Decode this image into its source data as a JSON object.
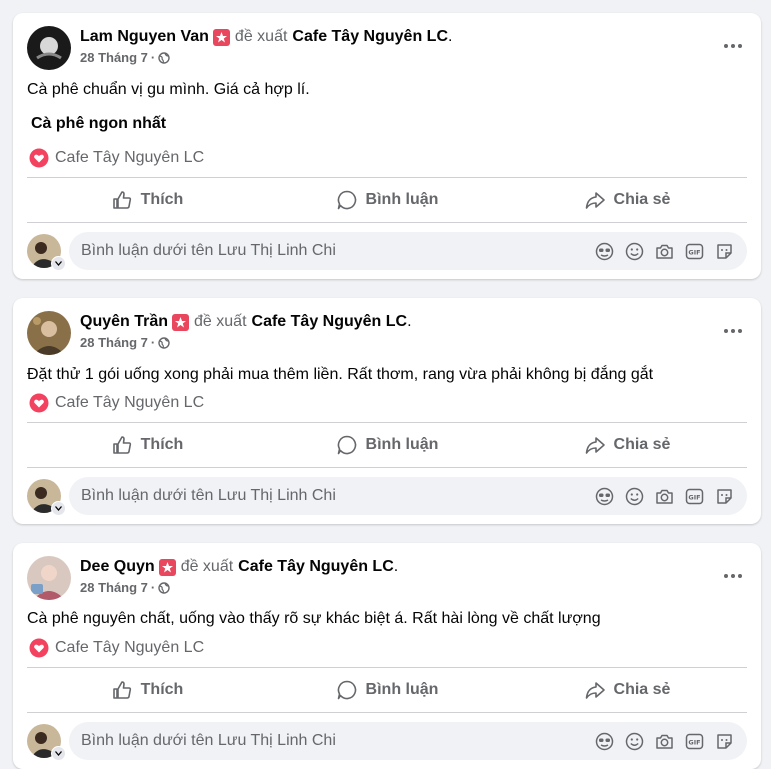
{
  "posts": [
    {
      "author": "Lam Nguyen Van",
      "verb": "đề xuất",
      "page": "Cafe Tây Nguyên LC",
      "date": "28 Tháng 7",
      "text": "Cà phê chuẩn vị gu mình. Giá cả hợp lí.",
      "bold_text": "Cà phê ngon nhất",
      "tag": "Cafe Tây Nguyên LC"
    },
    {
      "author": "Quyên Trần",
      "verb": "đề xuất",
      "page": "Cafe Tây Nguyên LC",
      "date": "28 Tháng 7",
      "text": "Đặt thử 1 gói uống xong phải mua thêm liền. Rất thơm, rang vừa phải không bị đắng gắt",
      "tag": "Cafe Tây Nguyên LC"
    },
    {
      "author": "Dee Quyn",
      "verb": "đề xuất",
      "page": "Cafe Tây Nguyên LC",
      "date": "28 Tháng 7",
      "text": "Cà phê nguyên chất, uống vào thấy rõ sự khác biệt á. Rất hài lòng về chất lượng",
      "tag": "Cafe Tây Nguyên LC"
    }
  ],
  "actions": {
    "like": "Thích",
    "comment": "Bình luận",
    "share": "Chia sẻ"
  },
  "comment_placeholder": "Bình luận dưới tên Lưu Thị Linh Chi",
  "separator": "·",
  "period": ".",
  "colors": {
    "badge": "#e8475e",
    "text": "#050505",
    "muted": "#65676b",
    "bg": "#f0f2f5"
  },
  "icons": [
    "globe-icon",
    "more-icon",
    "heart-icon",
    "like-icon",
    "comment-icon",
    "share-icon",
    "avatar-icon",
    "emoji-icon",
    "camera-icon",
    "gif-icon",
    "sticker-icon"
  ]
}
